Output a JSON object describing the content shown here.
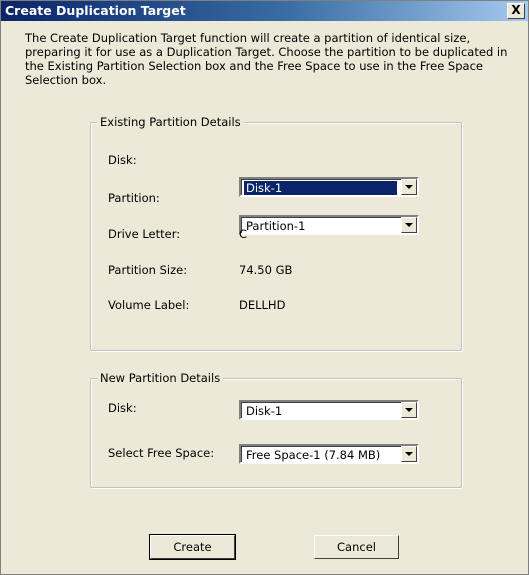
{
  "window": {
    "title": "Create Duplication Target",
    "close_glyph": "X"
  },
  "description": "The Create Duplication Target function will create a partition of identical size, preparing it for use as a Duplication Target. Choose the partition to be duplicated in the Existing Partition Selection box and the Free Space to use in the Free Space Selection box.",
  "existing": {
    "legend": "Existing Partition Details",
    "disk_label": "Disk:",
    "disk_value": "Disk-1",
    "partition_label": "Partition:",
    "partition_value": "Partition-1",
    "drive_letter_label": "Drive Letter:",
    "drive_letter_value": "C",
    "partition_size_label": "Partition Size:",
    "partition_size_value": "74.50 GB",
    "volume_label_label": "Volume Label:",
    "volume_label_value": "DELLHD"
  },
  "new_partition": {
    "legend": "New Partition Details",
    "disk_label": "Disk:",
    "disk_value": "Disk-1",
    "free_space_label": "Select Free Space:",
    "free_space_value": "Free Space-1 (7.84 MB)"
  },
  "buttons": {
    "create": "Create",
    "cancel": "Cancel"
  }
}
